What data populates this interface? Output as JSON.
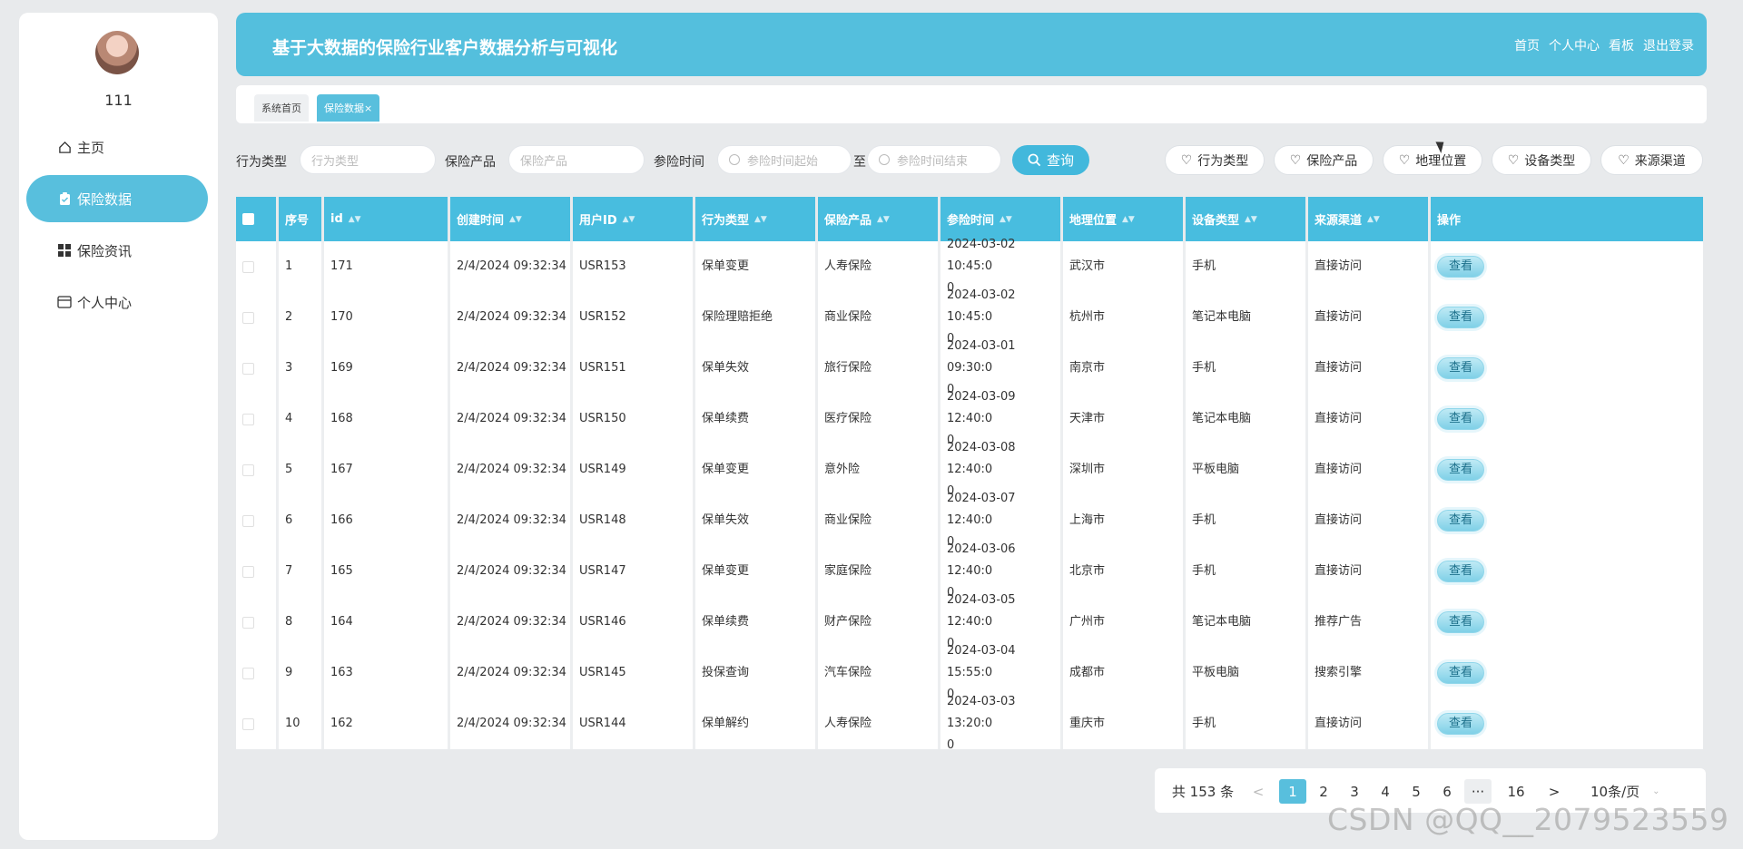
{
  "sidebar": {
    "username": "111",
    "items": [
      {
        "label": "主页",
        "icon": "home-icon"
      },
      {
        "label": "保险数据",
        "icon": "clipboard-icon"
      },
      {
        "label": "保险资讯",
        "icon": "grid-icon"
      },
      {
        "label": "个人中心",
        "icon": "card-icon"
      }
    ]
  },
  "header": {
    "title": "基于大数据的保险行业客户数据分析与可视化",
    "nav": [
      "首页",
      "个人中心",
      "看板",
      "退出登录"
    ]
  },
  "tabs": [
    {
      "label": "系统首页"
    },
    {
      "label": "保险数据",
      "close": "×"
    }
  ],
  "search": {
    "behavior_label": "行为类型",
    "behavior_placeholder": "行为类型",
    "product_label": "保险产品",
    "product_placeholder": "保险产品",
    "time_label": "参险时间",
    "time_start_placeholder": "参险时间起始",
    "to_label": "至",
    "time_end_placeholder": "参险时间结束",
    "query_button": "查询"
  },
  "chips": [
    "行为类型",
    "保险产品",
    "地理位置",
    "设备类型",
    "来源渠道"
  ],
  "table": {
    "headers": [
      "序号",
      "id",
      "创建时间",
      "用户ID",
      "行为类型",
      "保险产品",
      "参险时间",
      "地理位置",
      "设备类型",
      "来源渠道",
      "操作"
    ],
    "view_label": "查看",
    "rows": [
      {
        "no": "1",
        "id": "171",
        "created": "2/4/2024 09:32:34",
        "uid": "USR153",
        "behavior": "保单变更",
        "product": "人寿保险",
        "time1": "2024-03-02 10:45:0",
        "time2": "0",
        "location": "武汉市",
        "device": "手机",
        "channel": "直接访问"
      },
      {
        "no": "2",
        "id": "170",
        "created": "2/4/2024 09:32:34",
        "uid": "USR152",
        "behavior": "保险理赔拒绝",
        "product": "商业保险",
        "time1": "2024-03-02 10:45:0",
        "time2": "0",
        "location": "杭州市",
        "device": "笔记本电脑",
        "channel": "直接访问"
      },
      {
        "no": "3",
        "id": "169",
        "created": "2/4/2024 09:32:34",
        "uid": "USR151",
        "behavior": "保单失效",
        "product": "旅行保险",
        "time1": "2024-03-01 09:30:0",
        "time2": "0",
        "location": "南京市",
        "device": "手机",
        "channel": "直接访问"
      },
      {
        "no": "4",
        "id": "168",
        "created": "2/4/2024 09:32:34",
        "uid": "USR150",
        "behavior": "保单续费",
        "product": "医疗保险",
        "time1": "2024-03-09 12:40:0",
        "time2": "0",
        "location": "天津市",
        "device": "笔记本电脑",
        "channel": "直接访问"
      },
      {
        "no": "5",
        "id": "167",
        "created": "2/4/2024 09:32:34",
        "uid": "USR149",
        "behavior": "保单变更",
        "product": "意外险",
        "time1": "2024-03-08 12:40:0",
        "time2": "0",
        "location": "深圳市",
        "device": "平板电脑",
        "channel": "直接访问"
      },
      {
        "no": "6",
        "id": "166",
        "created": "2/4/2024 09:32:34",
        "uid": "USR148",
        "behavior": "保单失效",
        "product": "商业保险",
        "time1": "2024-03-07 12:40:0",
        "time2": "0",
        "location": "上海市",
        "device": "手机",
        "channel": "直接访问"
      },
      {
        "no": "7",
        "id": "165",
        "created": "2/4/2024 09:32:34",
        "uid": "USR147",
        "behavior": "保单变更",
        "product": "家庭保险",
        "time1": "2024-03-06 12:40:0",
        "time2": "0",
        "location": "北京市",
        "device": "手机",
        "channel": "直接访问"
      },
      {
        "no": "8",
        "id": "164",
        "created": "2/4/2024 09:32:34",
        "uid": "USR146",
        "behavior": "保单续费",
        "product": "财产保险",
        "time1": "2024-03-05 12:40:0",
        "time2": "0",
        "location": "广州市",
        "device": "笔记本电脑",
        "channel": "推荐广告"
      },
      {
        "no": "9",
        "id": "163",
        "created": "2/4/2024 09:32:34",
        "uid": "USR145",
        "behavior": "投保查询",
        "product": "汽车保险",
        "time1": "2024-03-04 15:55:0",
        "time2": "0",
        "location": "成都市",
        "device": "平板电脑",
        "channel": "搜索引擎"
      },
      {
        "no": "10",
        "id": "162",
        "created": "2/4/2024 09:32:34",
        "uid": "USR144",
        "behavior": "保单解约",
        "product": "人寿保险",
        "time1": "2024-03-03 13:20:0",
        "time2": "0",
        "location": "重庆市",
        "device": "手机",
        "channel": "直接访问"
      }
    ]
  },
  "pagination": {
    "total": "共 153 条",
    "prev": "<",
    "pages": [
      "1",
      "2",
      "3",
      "4",
      "5",
      "6"
    ],
    "more": "···",
    "last": "16",
    "next": ">",
    "size": "10条/页",
    "current": "1"
  },
  "watermark": "CSDN @QQ__2079523559",
  "colors": {
    "accent": "#54bfdd",
    "header_row": "#48bddf",
    "bg": "#e8eaec"
  }
}
